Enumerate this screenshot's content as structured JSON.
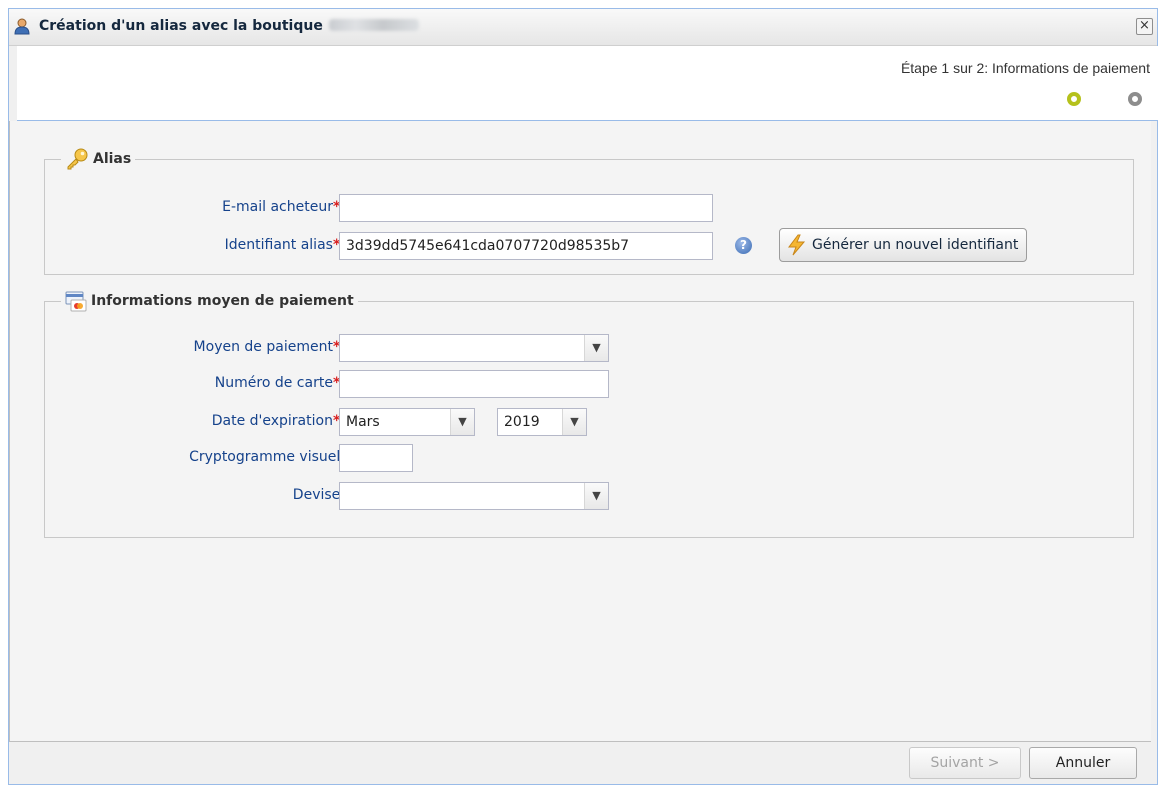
{
  "window": {
    "title": "Création d'un alias avec la boutique",
    "close_label": "×"
  },
  "steps": {
    "text": "Étape 1 sur 2: Informations de paiement"
  },
  "alias_group": {
    "legend": "Alias",
    "email_label": "E-mail acheteur",
    "email_value": "",
    "alias_id_label": "Identifiant alias",
    "alias_id_value": "3d39dd5745e641cda0707720d98535b7",
    "generate_button": "Générer un nouvel identifiant"
  },
  "payment_group": {
    "legend": "Informations moyen de paiement",
    "method_label": "Moyen de paiement",
    "method_value": "",
    "card_label": "Numéro de carte",
    "card_value": "",
    "expiry_label": "Date d'expiration",
    "expiry_month": "Mars",
    "expiry_year": "2019",
    "cvv_label": "Cryptogramme visuel",
    "cvv_value": "",
    "currency_label": "Devise",
    "currency_value": ""
  },
  "common": {
    "required_mark": "*",
    "colon": ":"
  },
  "footer": {
    "next_button": "Suivant >",
    "cancel_button": "Annuler"
  },
  "colors": {
    "step_active": "#b5c11c",
    "step_inactive": "#8d8d8d",
    "label": "#15428b",
    "required": "#d81f1f"
  }
}
